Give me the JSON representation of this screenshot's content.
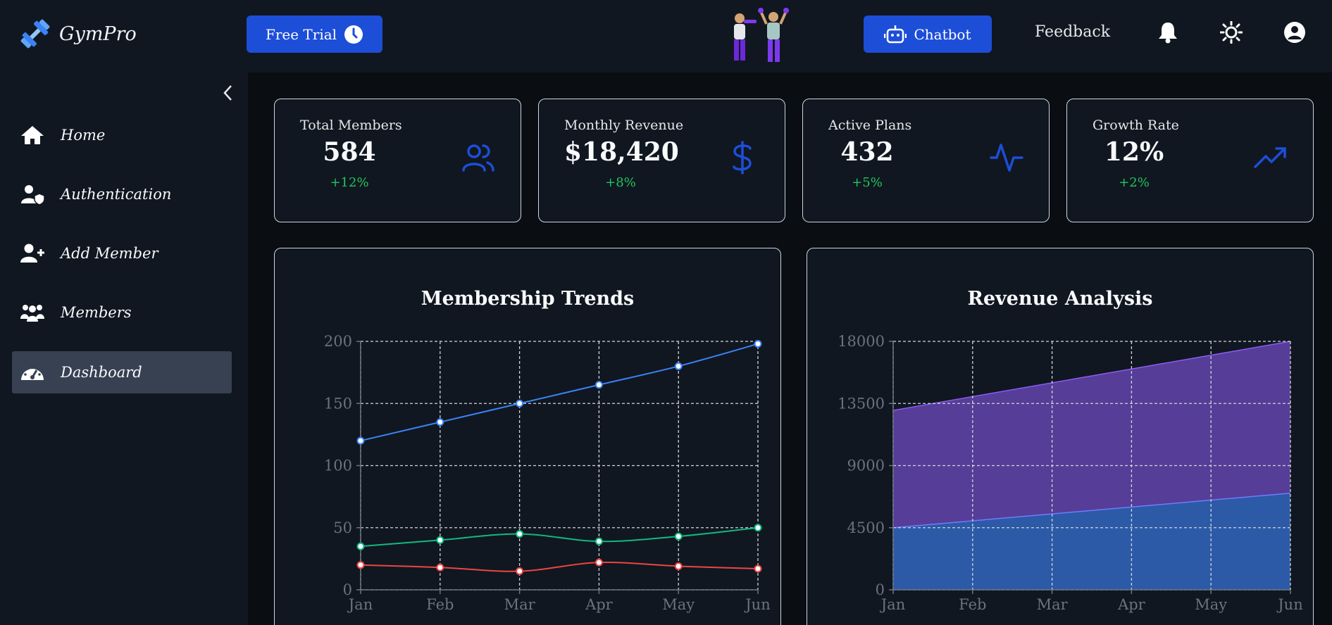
{
  "app": {
    "name": "GymPro"
  },
  "header": {
    "free_trial_label": "Free Trial",
    "chatbot_label": "Chatbot",
    "feedback_label": "Feedback",
    "icons": [
      "bell-icon",
      "sun-icon",
      "user-circle-icon"
    ]
  },
  "sidebar": {
    "items": [
      {
        "label": "Home",
        "icon": "home-icon"
      },
      {
        "label": "Authentication",
        "icon": "user-shield-icon"
      },
      {
        "label": "Add Member",
        "icon": "user-plus-icon"
      },
      {
        "label": "Members",
        "icon": "users-icon"
      },
      {
        "label": "Dashboard",
        "icon": "gauge-icon",
        "active": true
      }
    ]
  },
  "stats": [
    {
      "title": "Total Members",
      "value": "584",
      "change": "+12%",
      "icon": "users-icon"
    },
    {
      "title": "Monthly Revenue",
      "value": "$18,420",
      "change": "+8%",
      "icon": "dollar-icon"
    },
    {
      "title": "Active Plans",
      "value": "432",
      "change": "+5%",
      "icon": "activity-icon"
    },
    {
      "title": "Growth Rate",
      "value": "12%",
      "change": "+2%",
      "icon": "trending-up-icon"
    }
  ],
  "colors": {
    "accent": "#1d4ed8",
    "positive": "#22c55e",
    "series_blue": "#3b82f6",
    "series_green": "#10b981",
    "series_red": "#ef4444",
    "area_purple": "#5b3f9e",
    "area_blue": "#2a5ca8"
  },
  "chart_data": [
    {
      "type": "line",
      "title": "Membership Trends",
      "categories": [
        "Jan",
        "Feb",
        "Mar",
        "Apr",
        "May",
        "Jun"
      ],
      "series": [
        {
          "values": [
            120,
            135,
            150,
            165,
            180,
            198
          ],
          "color": "#3b82f6"
        },
        {
          "values": [
            35,
            40,
            45,
            39,
            43,
            50
          ],
          "color": "#10b981"
        },
        {
          "values": [
            20,
            18,
            15,
            22,
            19,
            17
          ],
          "color": "#ef4444"
        }
      ],
      "yticks": [
        "0",
        "50",
        "100",
        "150",
        "200"
      ],
      "ylim": [
        0,
        200
      ],
      "grid": true
    },
    {
      "type": "area",
      "title": "Revenue Analysis",
      "categories": [
        "Jan",
        "Feb",
        "Mar",
        "Apr",
        "May",
        "Jun"
      ],
      "series": [
        {
          "values": [
            4500,
            5000,
            5500,
            6000,
            6500,
            7000
          ],
          "color": "#2a5ca8"
        },
        {
          "values": [
            13000,
            14000,
            15000,
            16000,
            17000,
            18000
          ],
          "color": "#5b3f9e"
        }
      ],
      "yticks": [
        "0",
        "4500",
        "9000",
        "13500",
        "18000"
      ],
      "ylim": [
        0,
        18000
      ],
      "grid": true
    }
  ]
}
